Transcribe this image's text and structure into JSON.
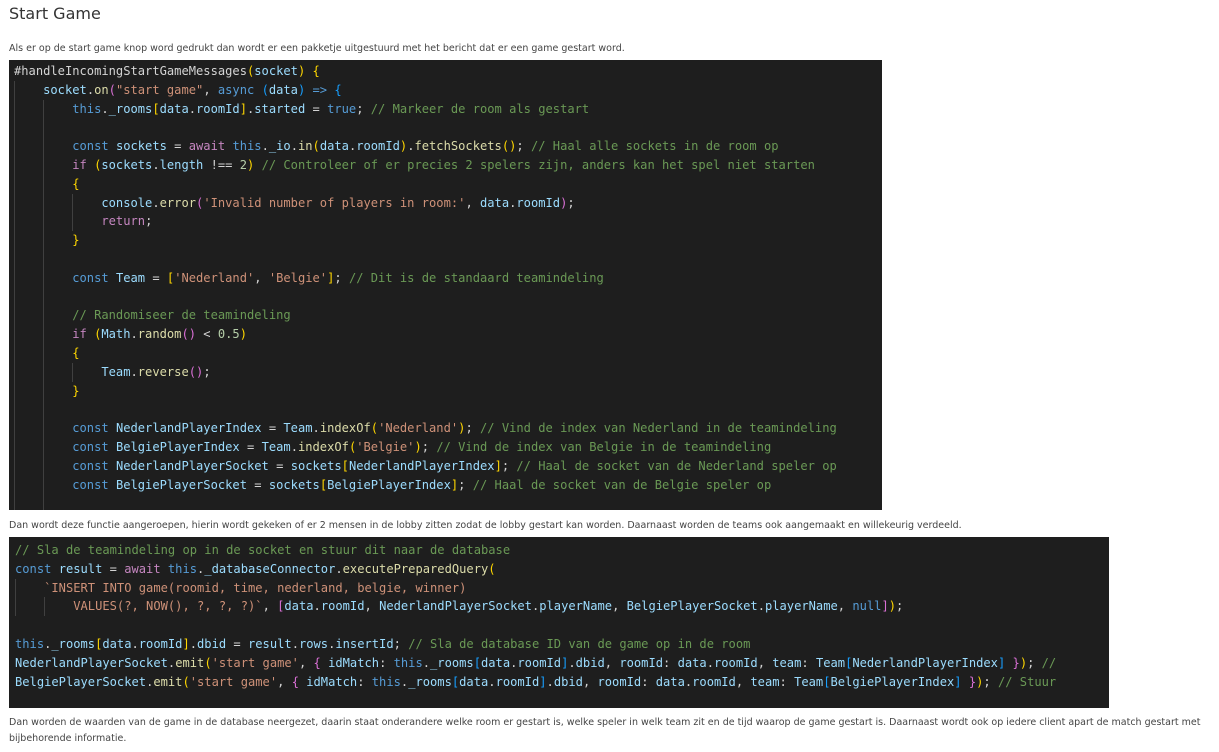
{
  "page": {
    "title": "Start Game",
    "intro": "Als er op de start game knop word gedrukt dan wordt er een pakketje uitgestuurd met het bericht dat er een game gestart word.",
    "middle": "Dan wordt deze functie aangeroepen, hierin wordt gekeken of er 2 mensen in de lobby zitten zodat de lobby gestart kan worden. Daarnaast worden de teams ook aangemaakt en willekeurig verdeeld.",
    "outro": "Dan worden de waarden van de game in de database neergezet, daarin staat onderandere welke room er gestart is, welke speler in welk team zit en de tijd waarop de game gestart is. Daarnaast wordt ook op iedere client apart de match gestart met bijbehorende informatie."
  },
  "code1": [
    [
      [
        "d",
        "#handleIncomingStartGameMessages"
      ],
      [
        "b1",
        "("
      ],
      [
        "v",
        "socket"
      ],
      [
        "b1",
        ")"
      ],
      [
        "d",
        " "
      ],
      [
        "b1",
        "{"
      ]
    ],
    [
      [
        "d",
        "    "
      ],
      [
        "v",
        "socket"
      ],
      [
        "d",
        "."
      ],
      [
        "f",
        "on"
      ],
      [
        "b2",
        "("
      ],
      [
        "s",
        "\"start game\""
      ],
      [
        "d",
        ", "
      ],
      [
        "k",
        "async"
      ],
      [
        "d",
        " "
      ],
      [
        "b3",
        "("
      ],
      [
        "v",
        "data"
      ],
      [
        "b3",
        ")"
      ],
      [
        "d",
        " "
      ],
      [
        "k",
        "=>"
      ],
      [
        "d",
        " "
      ],
      [
        "b3",
        "{"
      ]
    ],
    [
      [
        "d",
        "        "
      ],
      [
        "k",
        "this"
      ],
      [
        "d",
        "."
      ],
      [
        "v",
        "_rooms"
      ],
      [
        "b1",
        "["
      ],
      [
        "v",
        "data"
      ],
      [
        "d",
        "."
      ],
      [
        "v",
        "roomId"
      ],
      [
        "b1",
        "]"
      ],
      [
        "d",
        "."
      ],
      [
        "v",
        "started"
      ],
      [
        "d",
        " = "
      ],
      [
        "k",
        "true"
      ],
      [
        "d",
        "; "
      ],
      [
        "m",
        "// Markeer de room als gestart"
      ]
    ],
    [],
    [
      [
        "d",
        "        "
      ],
      [
        "k",
        "const"
      ],
      [
        "d",
        " "
      ],
      [
        "v",
        "sockets"
      ],
      [
        "d",
        " = "
      ],
      [
        "c",
        "await"
      ],
      [
        "d",
        " "
      ],
      [
        "k",
        "this"
      ],
      [
        "d",
        "."
      ],
      [
        "v",
        "_io"
      ],
      [
        "d",
        "."
      ],
      [
        "f",
        "in"
      ],
      [
        "b1",
        "("
      ],
      [
        "v",
        "data"
      ],
      [
        "d",
        "."
      ],
      [
        "v",
        "roomId"
      ],
      [
        "b1",
        ")"
      ],
      [
        "d",
        "."
      ],
      [
        "f",
        "fetchSockets"
      ],
      [
        "b1",
        "()"
      ],
      [
        "d",
        "; "
      ],
      [
        "m",
        "// Haal alle sockets in de room op"
      ]
    ],
    [
      [
        "d",
        "        "
      ],
      [
        "c",
        "if"
      ],
      [
        "d",
        " "
      ],
      [
        "b1",
        "("
      ],
      [
        "v",
        "sockets"
      ],
      [
        "d",
        "."
      ],
      [
        "v",
        "length"
      ],
      [
        "d",
        " !== "
      ],
      [
        "n",
        "2"
      ],
      [
        "b1",
        ")"
      ],
      [
        "d",
        " "
      ],
      [
        "m",
        "// Controleer of er precies 2 spelers zijn, anders kan het spel niet starten"
      ]
    ],
    [
      [
        "d",
        "        "
      ],
      [
        "b1",
        "{"
      ]
    ],
    [
      [
        "d",
        "            "
      ],
      [
        "v",
        "console"
      ],
      [
        "d",
        "."
      ],
      [
        "f",
        "error"
      ],
      [
        "b2",
        "("
      ],
      [
        "s",
        "'Invalid number of players in room:'"
      ],
      [
        "d",
        ", "
      ],
      [
        "v",
        "data"
      ],
      [
        "d",
        "."
      ],
      [
        "v",
        "roomId"
      ],
      [
        "b2",
        ")"
      ],
      [
        "d",
        ";"
      ]
    ],
    [
      [
        "d",
        "            "
      ],
      [
        "c",
        "return"
      ],
      [
        "d",
        ";"
      ]
    ],
    [
      [
        "d",
        "        "
      ],
      [
        "b1",
        "}"
      ]
    ],
    [],
    [
      [
        "d",
        "        "
      ],
      [
        "k",
        "const"
      ],
      [
        "d",
        " "
      ],
      [
        "v",
        "Team"
      ],
      [
        "d",
        " = "
      ],
      [
        "b1",
        "["
      ],
      [
        "s",
        "'Nederland'"
      ],
      [
        "d",
        ", "
      ],
      [
        "s",
        "'Belgie'"
      ],
      [
        "b1",
        "]"
      ],
      [
        "d",
        "; "
      ],
      [
        "m",
        "// Dit is de standaard teamindeling"
      ]
    ],
    [],
    [
      [
        "d",
        "        "
      ],
      [
        "m",
        "// Randomiseer de teamindeling"
      ]
    ],
    [
      [
        "d",
        "        "
      ],
      [
        "c",
        "if"
      ],
      [
        "d",
        " "
      ],
      [
        "b1",
        "("
      ],
      [
        "v",
        "Math"
      ],
      [
        "d",
        "."
      ],
      [
        "f",
        "random"
      ],
      [
        "b2",
        "()"
      ],
      [
        "d",
        " < "
      ],
      [
        "n",
        "0.5"
      ],
      [
        "b1",
        ")"
      ]
    ],
    [
      [
        "d",
        "        "
      ],
      [
        "b1",
        "{"
      ]
    ],
    [
      [
        "d",
        "            "
      ],
      [
        "v",
        "Team"
      ],
      [
        "d",
        "."
      ],
      [
        "f",
        "reverse"
      ],
      [
        "b2",
        "()"
      ],
      [
        "d",
        ";"
      ]
    ],
    [
      [
        "d",
        "        "
      ],
      [
        "b1",
        "}"
      ]
    ],
    [],
    [
      [
        "d",
        "        "
      ],
      [
        "k",
        "const"
      ],
      [
        "d",
        " "
      ],
      [
        "v",
        "NederlandPlayerIndex"
      ],
      [
        "d",
        " = "
      ],
      [
        "v",
        "Team"
      ],
      [
        "d",
        "."
      ],
      [
        "f",
        "indexOf"
      ],
      [
        "b1",
        "("
      ],
      [
        "s",
        "'Nederland'"
      ],
      [
        "b1",
        ")"
      ],
      [
        "d",
        "; "
      ],
      [
        "m",
        "// Vind de index van Nederland in de teamindeling"
      ]
    ],
    [
      [
        "d",
        "        "
      ],
      [
        "k",
        "const"
      ],
      [
        "d",
        " "
      ],
      [
        "v",
        "BelgiePlayerIndex"
      ],
      [
        "d",
        " = "
      ],
      [
        "v",
        "Team"
      ],
      [
        "d",
        "."
      ],
      [
        "f",
        "indexOf"
      ],
      [
        "b1",
        "("
      ],
      [
        "s",
        "'Belgie'"
      ],
      [
        "b1",
        ")"
      ],
      [
        "d",
        "; "
      ],
      [
        "m",
        "// Vind de index van Belgie in de teamindeling"
      ]
    ],
    [
      [
        "d",
        "        "
      ],
      [
        "k",
        "const"
      ],
      [
        "d",
        " "
      ],
      [
        "v",
        "NederlandPlayerSocket"
      ],
      [
        "d",
        " = "
      ],
      [
        "v",
        "sockets"
      ],
      [
        "b1",
        "["
      ],
      [
        "v",
        "NederlandPlayerIndex"
      ],
      [
        "b1",
        "]"
      ],
      [
        "d",
        "; "
      ],
      [
        "m",
        "// Haal de socket van de Nederland speler op"
      ]
    ],
    [
      [
        "d",
        "        "
      ],
      [
        "k",
        "const"
      ],
      [
        "d",
        " "
      ],
      [
        "v",
        "BelgiePlayerSocket"
      ],
      [
        "d",
        " = "
      ],
      [
        "v",
        "sockets"
      ],
      [
        "b1",
        "["
      ],
      [
        "v",
        "BelgiePlayerIndex"
      ],
      [
        "b1",
        "]"
      ],
      [
        "d",
        "; "
      ],
      [
        "m",
        "// Haal de socket van de Belgie speler op"
      ]
    ],
    []
  ],
  "code2": [
    [
      [
        "m",
        "// Sla de teamindeling op in de socket en stuur dit naar de database"
      ]
    ],
    [
      [
        "k",
        "const"
      ],
      [
        "d",
        " "
      ],
      [
        "v",
        "result"
      ],
      [
        "d",
        " = "
      ],
      [
        "c",
        "await"
      ],
      [
        "d",
        " "
      ],
      [
        "k",
        "this"
      ],
      [
        "d",
        "."
      ],
      [
        "v",
        "_databaseConnector"
      ],
      [
        "d",
        "."
      ],
      [
        "f",
        "executePreparedQuery"
      ],
      [
        "b1",
        "("
      ]
    ],
    [
      [
        "d",
        "    "
      ],
      [
        "s",
        "`INSERT INTO game(roomid, time, nederland, belgie, winner)"
      ]
    ],
    [
      [
        "s",
        "        VALUES(?, NOW(), ?, ?, ?)`"
      ],
      [
        "d",
        ", "
      ],
      [
        "b2",
        "["
      ],
      [
        "v",
        "data"
      ],
      [
        "d",
        "."
      ],
      [
        "v",
        "roomId"
      ],
      [
        "d",
        ", "
      ],
      [
        "v",
        "NederlandPlayerSocket"
      ],
      [
        "d",
        "."
      ],
      [
        "v",
        "playerName"
      ],
      [
        "d",
        ", "
      ],
      [
        "v",
        "BelgiePlayerSocket"
      ],
      [
        "d",
        "."
      ],
      [
        "v",
        "playerName"
      ],
      [
        "d",
        ", "
      ],
      [
        "k",
        "null"
      ],
      [
        "b2",
        "]"
      ],
      [
        "b1",
        ")"
      ],
      [
        "d",
        ";"
      ]
    ],
    [],
    [
      [
        "k",
        "this"
      ],
      [
        "d",
        "."
      ],
      [
        "v",
        "_rooms"
      ],
      [
        "b1",
        "["
      ],
      [
        "v",
        "data"
      ],
      [
        "d",
        "."
      ],
      [
        "v",
        "roomId"
      ],
      [
        "b1",
        "]"
      ],
      [
        "d",
        "."
      ],
      [
        "v",
        "dbid"
      ],
      [
        "d",
        " = "
      ],
      [
        "v",
        "result"
      ],
      [
        "d",
        "."
      ],
      [
        "v",
        "rows"
      ],
      [
        "d",
        "."
      ],
      [
        "v",
        "insertId"
      ],
      [
        "d",
        "; "
      ],
      [
        "m",
        "// Sla de database ID van de game op in de room"
      ]
    ],
    [
      [
        "v",
        "NederlandPlayerSocket"
      ],
      [
        "d",
        "."
      ],
      [
        "f",
        "emit"
      ],
      [
        "b1",
        "("
      ],
      [
        "s",
        "'start game'"
      ],
      [
        "d",
        ", "
      ],
      [
        "b2",
        "{"
      ],
      [
        "d",
        " "
      ],
      [
        "v",
        "idMatch"
      ],
      [
        "d",
        ": "
      ],
      [
        "k",
        "this"
      ],
      [
        "d",
        "."
      ],
      [
        "v",
        "_rooms"
      ],
      [
        "b3",
        "["
      ],
      [
        "v",
        "data"
      ],
      [
        "d",
        "."
      ],
      [
        "v",
        "roomId"
      ],
      [
        "b3",
        "]"
      ],
      [
        "d",
        "."
      ],
      [
        "v",
        "dbid"
      ],
      [
        "d",
        ", "
      ],
      [
        "v",
        "roomId"
      ],
      [
        "d",
        ": "
      ],
      [
        "v",
        "data"
      ],
      [
        "d",
        "."
      ],
      [
        "v",
        "roomId"
      ],
      [
        "d",
        ", "
      ],
      [
        "v",
        "team"
      ],
      [
        "d",
        ": "
      ],
      [
        "v",
        "Team"
      ],
      [
        "b3",
        "["
      ],
      [
        "v",
        "NederlandPlayerIndex"
      ],
      [
        "b3",
        "]"
      ],
      [
        "d",
        " "
      ],
      [
        "b2",
        "}"
      ],
      [
        "b1",
        ")"
      ],
      [
        "d",
        "; "
      ],
      [
        "m",
        "//"
      ]
    ],
    [
      [
        "v",
        "BelgiePlayerSocket"
      ],
      [
        "d",
        "."
      ],
      [
        "f",
        "emit"
      ],
      [
        "b1",
        "("
      ],
      [
        "s",
        "'start game'"
      ],
      [
        "d",
        ", "
      ],
      [
        "b2",
        "{"
      ],
      [
        "d",
        " "
      ],
      [
        "v",
        "idMatch"
      ],
      [
        "d",
        ": "
      ],
      [
        "k",
        "this"
      ],
      [
        "d",
        "."
      ],
      [
        "v",
        "_rooms"
      ],
      [
        "b3",
        "["
      ],
      [
        "v",
        "data"
      ],
      [
        "d",
        "."
      ],
      [
        "v",
        "roomId"
      ],
      [
        "b3",
        "]"
      ],
      [
        "d",
        "."
      ],
      [
        "v",
        "dbid"
      ],
      [
        "d",
        ", "
      ],
      [
        "v",
        "roomId"
      ],
      [
        "d",
        ": "
      ],
      [
        "v",
        "data"
      ],
      [
        "d",
        "."
      ],
      [
        "v",
        "roomId"
      ],
      [
        "d",
        ", "
      ],
      [
        "v",
        "team"
      ],
      [
        "d",
        ": "
      ],
      [
        "v",
        "Team"
      ],
      [
        "b3",
        "["
      ],
      [
        "v",
        "BelgiePlayerIndex"
      ],
      [
        "b3",
        "]"
      ],
      [
        "d",
        " "
      ],
      [
        "b2",
        "}"
      ],
      [
        "b1",
        ")"
      ],
      [
        "d",
        "; "
      ],
      [
        "m",
        "// Stuur"
      ]
    ]
  ]
}
